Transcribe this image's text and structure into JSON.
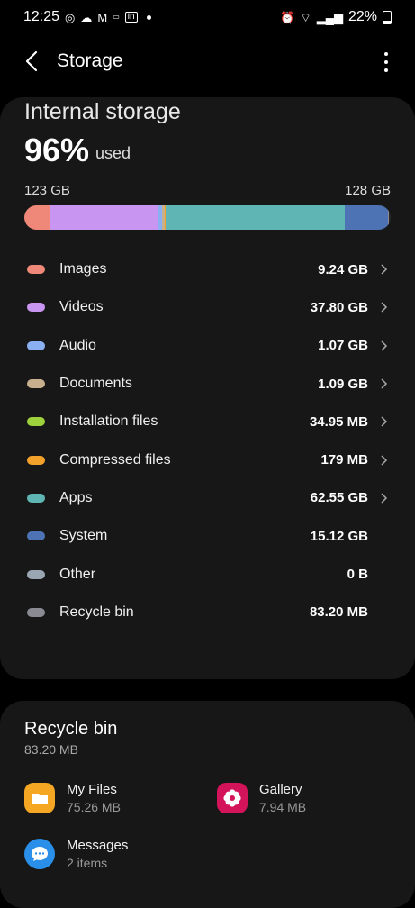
{
  "status_bar": {
    "time": "12:25",
    "battery": "22%"
  },
  "header": {
    "title": "Storage"
  },
  "internal": {
    "title": "Internal storage",
    "percent": "96%",
    "used_label": "used",
    "used_gb": "123 GB",
    "total_gb": "128 GB",
    "usage_fraction": 0.96
  },
  "categories": [
    {
      "label": "Images",
      "size": "9.24 GB",
      "color": "#ef8878",
      "chevron": true,
      "bar_fraction": 0.072
    },
    {
      "label": "Videos",
      "size": "37.80 GB",
      "color": "#c896f0",
      "chevron": true,
      "bar_fraction": 0.295
    },
    {
      "label": "Audio",
      "size": "1.07 GB",
      "color": "#8ab0f2",
      "chevron": true,
      "bar_fraction": 0.008
    },
    {
      "label": "Documents",
      "size": "1.09 GB",
      "color": "#c8b08e",
      "chevron": true,
      "bar_fraction": 0.008
    },
    {
      "label": "Installation files",
      "size": "34.95 MB",
      "color": "#9dd23c",
      "chevron": true,
      "bar_fraction": 0.001
    },
    {
      "label": "Compressed files",
      "size": "179 MB",
      "color": "#f2a12a",
      "chevron": true,
      "bar_fraction": 0.002
    },
    {
      "label": "Apps",
      "size": "62.55 GB",
      "color": "#5fb5b3",
      "chevron": true,
      "bar_fraction": 0.489
    },
    {
      "label": "System",
      "size": "15.12 GB",
      "color": "#4e73b4",
      "chevron": false,
      "bar_fraction": 0.118
    },
    {
      "label": "Other",
      "size": "0 B",
      "color": "#9aa6b2",
      "chevron": false,
      "bar_fraction": 0
    },
    {
      "label": "Recycle bin",
      "size": "83.20 MB",
      "color": "#8a8a92",
      "chevron": false,
      "bar_fraction": 0.001
    }
  ],
  "recycle_bin": {
    "title": "Recycle bin",
    "size": "83.20 MB",
    "apps": [
      {
        "name": "My Files",
        "sub": "75.26 MB",
        "icon": "folder-icon",
        "color": "#f5a623"
      },
      {
        "name": "Gallery",
        "sub": "7.94 MB",
        "icon": "flower-icon",
        "color": "#d4145a"
      },
      {
        "name": "Messages",
        "sub": "2 items",
        "icon": "chat-bubble-icon",
        "color": "#2a8fe8"
      }
    ]
  }
}
